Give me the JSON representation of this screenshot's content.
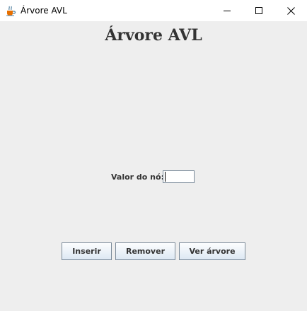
{
  "window": {
    "title": "Árvore AVL",
    "icon": "java-cup-icon"
  },
  "main": {
    "heading": "Árvore AVL",
    "node_label": "Valor do nó:",
    "node_value": "",
    "buttons": {
      "insert": "Inserir",
      "remove": "Remover",
      "view_tree": "Ver árvore"
    }
  },
  "colors": {
    "background": "#eeeeee",
    "button_border": "#7a8a99",
    "text": "#333333"
  }
}
